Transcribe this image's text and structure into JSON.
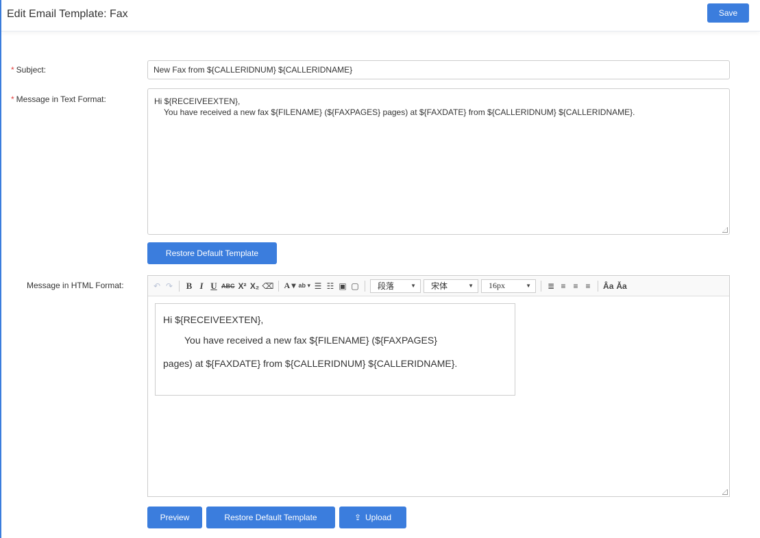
{
  "header": {
    "title": "Edit Email Template: Fax",
    "save_label": "Save"
  },
  "subject": {
    "label": "Subject:",
    "value": "New Fax from ${CALLERIDNUM} ${CALLERIDNAME}"
  },
  "text_format": {
    "label": "Message in Text Format:",
    "line1": "Hi ${RECEIVEEXTEN},",
    "line2": "You have received a new fax ${FILENAME} (${FAXPAGES} pages) at ${FAXDATE} from ${CALLERIDNUM} ${CALLERIDNAME}.",
    "restore_label": "Restore Default Template"
  },
  "html_format": {
    "label": "Message in HTML Format:",
    "toolbar": {
      "paragraph": "段落",
      "font": "宋体",
      "size": "16px"
    },
    "body_line1": "Hi ${RECEIVEEXTEN},",
    "body_line2": "You have received a new fax ${FILENAME} (${FAXPAGES}",
    "body_line3": "pages) at ${FAXDATE} from ${CALLERIDNUM} ${CALLERIDNAME}.",
    "preview_label": "Preview",
    "restore_label": "Restore Default Template",
    "upload_label": "Upload"
  },
  "colors": {
    "accent": "#3b7ddd",
    "required": "#e0403f"
  }
}
